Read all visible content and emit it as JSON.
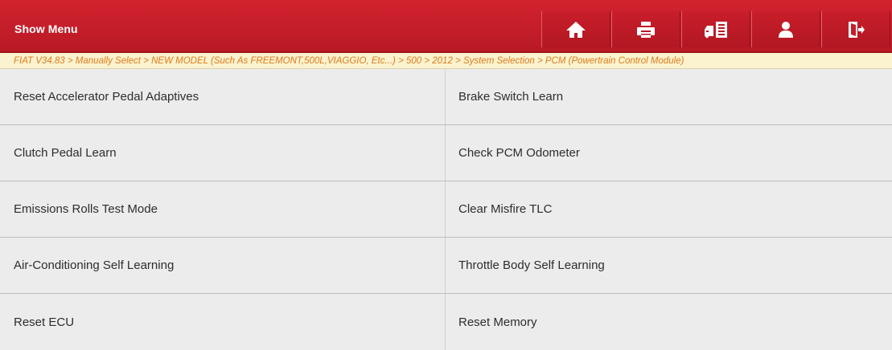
{
  "header": {
    "title": "Show Menu",
    "accent": "#c41e2a",
    "toolbar": [
      {
        "icon": "home-icon"
      },
      {
        "icon": "print-icon"
      },
      {
        "icon": "vehicle-report-icon"
      },
      {
        "icon": "user-icon"
      },
      {
        "icon": "exit-icon"
      }
    ]
  },
  "breadcrumb": {
    "text": "FIAT V34.83 > Manually Select > NEW MODEL (Such As FREEMONT,500L,VIAGGIO, Etc...) > 500 > 2012 > System Selection > PCM (Powertrain Control Module)",
    "color": "#df7a1a",
    "background": "#fbf3cf"
  },
  "menu": {
    "items": [
      {
        "label": "Reset Accelerator Pedal Adaptives"
      },
      {
        "label": "Brake Switch Learn"
      },
      {
        "label": "Clutch Pedal Learn"
      },
      {
        "label": "Check PCM Odometer"
      },
      {
        "label": "Emissions Rolls Test Mode"
      },
      {
        "label": "Clear Misfire TLC"
      },
      {
        "label": "Air-Conditioning Self Learning"
      },
      {
        "label": "Throttle Body Self Learning"
      },
      {
        "label": "Reset ECU"
      },
      {
        "label": "Reset Memory"
      }
    ]
  }
}
